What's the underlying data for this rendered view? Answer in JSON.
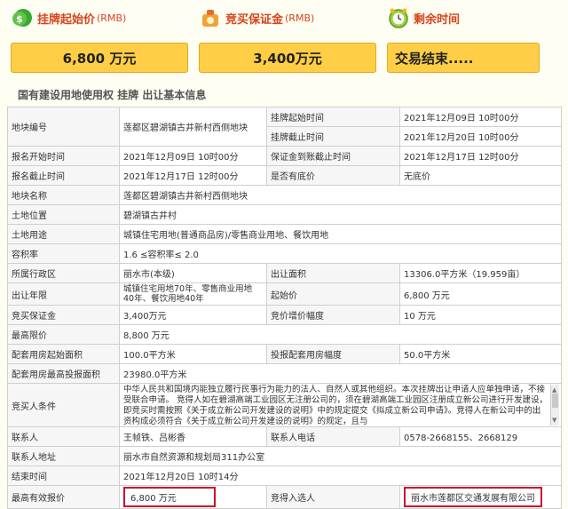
{
  "header": {
    "start_price": {
      "label": "挂牌起始价",
      "unit": "(RMB)",
      "value": "6,800 万元"
    },
    "deposit": {
      "label": "竞买保证金",
      "unit": "(RMB)",
      "value": "3,400万元"
    },
    "time_left": {
      "label": "剩余时间",
      "value": "交易结束....."
    }
  },
  "section_title": "国有建设用地使用权 挂牌 出让基本信息",
  "rows": {
    "r1": {
      "k1": "地块编号",
      "v1": "莲都区碧湖镇古井新村西侧地块",
      "k2a": "挂牌起始时间",
      "v2a": "2021年12月09日 10时00分",
      "k2b": "挂牌截止时间",
      "v2b": "2021年12月20日 10时00分"
    },
    "r2": {
      "k1": "报名开始时间",
      "v1": "2021年12月09日 10时00分",
      "k2": "保证金到账截止时间",
      "v2": "2021年12月17日 12时00分"
    },
    "r3": {
      "k1": "报名截止时间",
      "v1": "2021年12月17日 12时00分",
      "k2": "是否有底价",
      "v2": "无底价"
    },
    "r4": {
      "k": "地块名称",
      "v": "莲都区碧湖镇古井新村西侧地块"
    },
    "r5": {
      "k": "土地位置",
      "v": "碧湖镇古井村"
    },
    "r6": {
      "k": "土地用途",
      "v": "城镇住宅用地(普通商品房)/零售商业用地、餐饮用地"
    },
    "r7": {
      "k": "容积率",
      "v": "1.6 ≤容积率≤ 2.0"
    },
    "r8": {
      "k1": "所属行政区",
      "v1": "丽水市(本级)",
      "k2": "出让面积",
      "v2": "13306.0平方米（19.959亩）"
    },
    "r9": {
      "k1": "出让年限",
      "v1": "城镇住宅用地70年、零售商业用地40年、餐饮用地40年",
      "k2": "起始价",
      "v2": "6,800 万元"
    },
    "r10": {
      "k1": "竞买保证金",
      "v1": "3,400万元",
      "k2": "竞价增价幅度",
      "v2": "10 万元"
    },
    "r11": {
      "k": "最高限价",
      "v": "8,800 万元"
    },
    "r12": {
      "k1": "配套用房起始面积",
      "v1": "100.0平方米",
      "k2": "投报配套用房幅度",
      "v2": "50.0平方米"
    },
    "r13": {
      "k": "配套用房最高投报面积",
      "v": "23980.0平方米"
    },
    "r14": {
      "k": "竞买人条件",
      "v": "中华人民共和国境内能独立履行民事行为能力的法人、自然人或其他组织。本次挂牌出让申请人应单独申请，不接受联合申请。 竞得人如在碧湖高端工业园区无注册公司的，须在碧湖高端工业园区注册成立新公司进行开发建设，即竞买时需按照《关于成立新公司开发建设的说明》中的规定提交《拟成立新公司申请》。竞得人在新公司中的出资构成必须符合《关于成立新公司开发建设的说明》的规定，且与"
    },
    "r15": {
      "k1": "联系人",
      "v1": "王帧铁、吕彬香",
      "k2": "联系人电话",
      "v2": "0578-2668155、2668129"
    },
    "r16": {
      "k": "联系人地址",
      "v": "丽水市自然资源和规划局311办公室"
    },
    "r17": {
      "k": "结束时间",
      "v": "2021年12月20日 10时14分"
    },
    "r18": {
      "k1": "最高有效报价",
      "v1": "6,800 万元",
      "k2": "竞得入选人",
      "v2": "丽水市莲都区交通发展有限公司"
    }
  }
}
